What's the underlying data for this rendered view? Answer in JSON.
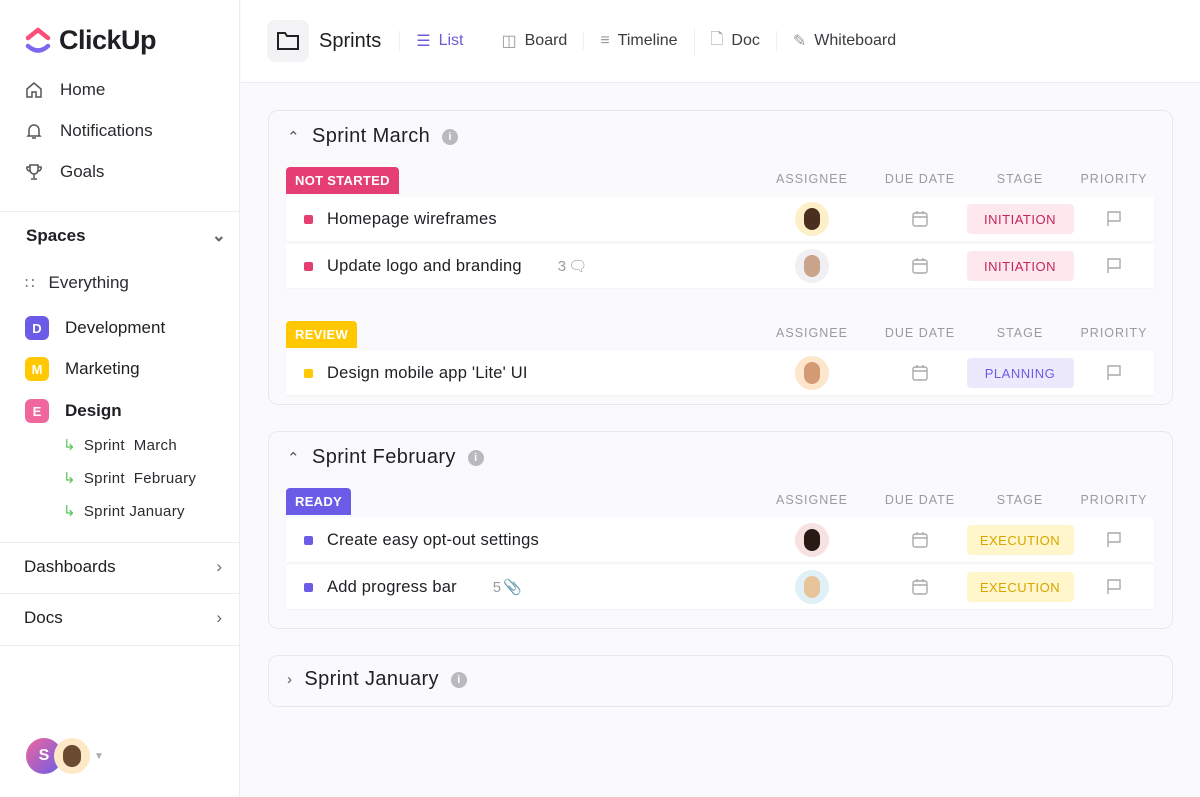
{
  "app": {
    "name": "ClickUp"
  },
  "sidebar": {
    "nav": [
      {
        "label": "Home"
      },
      {
        "label": "Notifications"
      },
      {
        "label": "Goals"
      }
    ],
    "spaces_label": "Spaces",
    "everything": "Everything",
    "spaces": [
      {
        "letter": "D",
        "label": "Development",
        "color": "#6b5ce7"
      },
      {
        "letter": "M",
        "label": "Marketing",
        "color": "#ffc800"
      },
      {
        "letter": "E",
        "label": "Design",
        "color": "#f0679e"
      }
    ],
    "sublists": [
      "Sprint  March",
      "Sprint  February",
      "Sprint January"
    ],
    "dashboards": "Dashboards",
    "docs": "Docs",
    "user_initial": "S"
  },
  "header": {
    "title": "Sprints",
    "tabs": [
      "List",
      "Board",
      "Timeline",
      "Doc",
      "Whiteboard"
    ]
  },
  "columns": [
    "ASSIGNEE",
    "DUE DATE",
    "STAGE",
    "PRIORITY"
  ],
  "sprints": [
    {
      "title": "Sprint March",
      "groups": [
        {
          "status": "NOT STARTED",
          "color": "#e43e72",
          "tasks": [
            {
              "name": "Homepage wireframes",
              "stage": "INITIATION"
            },
            {
              "name": "Update logo and branding",
              "extra": "3",
              "stage": "INITIATION"
            }
          ]
        },
        {
          "status": "REVIEW",
          "color": "#ffc800",
          "tasks": [
            {
              "name": "Design mobile app 'Lite' UI",
              "stage": "PLANNING"
            }
          ]
        }
      ]
    },
    {
      "title": "Sprint February",
      "groups": [
        {
          "status": "READY",
          "color": "#6b5ce7",
          "tasks": [
            {
              "name": "Create easy opt-out settings",
              "stage": "EXECUTION"
            },
            {
              "name": "Add progress bar",
              "extra": "5",
              "stage": "EXECUTION"
            }
          ]
        }
      ]
    },
    {
      "title": "Sprint January"
    }
  ]
}
